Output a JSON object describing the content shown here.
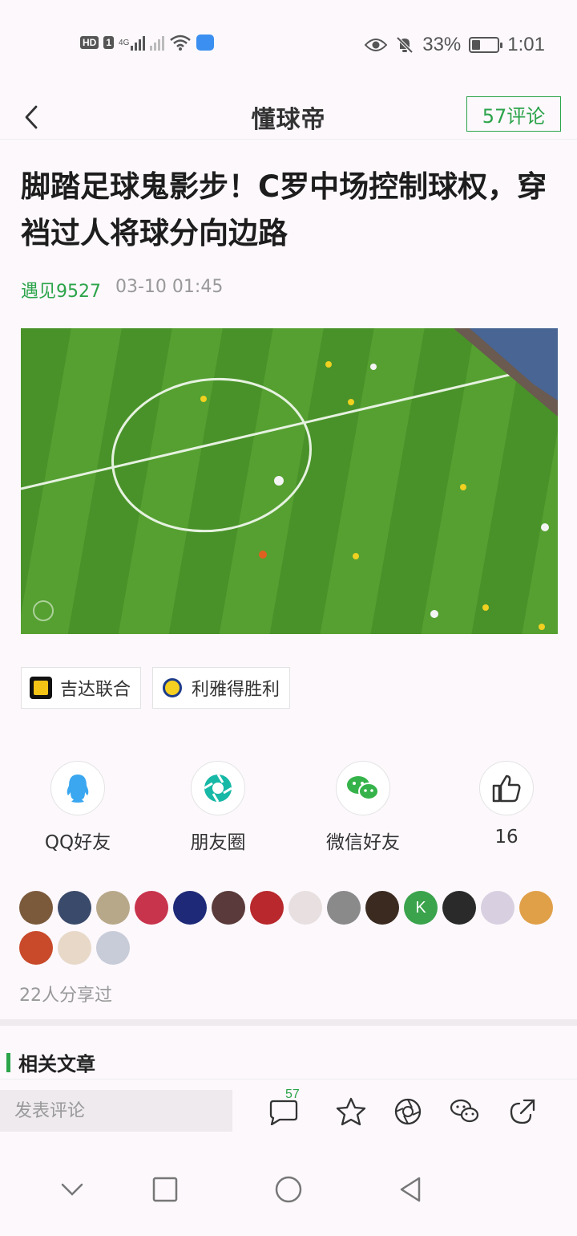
{
  "status_bar": {
    "left_hd": "HD",
    "left_sim": "1",
    "left_net": "4G",
    "battery_pct": "33%",
    "battery_level": 0.33,
    "time": "1:01"
  },
  "header": {
    "brand": "懂球帝",
    "comment_button": "57评论"
  },
  "article": {
    "title": "脚踏足球鬼影步！C罗中场控制球权，穿裆过人将球分向边路",
    "author": "遇见9527",
    "timestamp": "03-10 01:45"
  },
  "tags": [
    {
      "label": "吉达联合",
      "logo": "ittihad-logo",
      "color": "#f3c316"
    },
    {
      "label": "利雅得胜利",
      "logo": "al-nassr-logo",
      "color": "#f5d020"
    }
  ],
  "share": {
    "items": [
      {
        "label": "QQ好友",
        "icon": "qq-icon"
      },
      {
        "label": "朋友圈",
        "icon": "moments-icon"
      },
      {
        "label": "微信好友",
        "icon": "wechat-icon"
      },
      {
        "label": "16",
        "icon": "thumbs-up-icon"
      }
    ],
    "avatars": [
      {
        "color": "#7b5a3c",
        "text": ""
      },
      {
        "color": "#3a4a6a",
        "text": ""
      },
      {
        "color": "#b8a88a",
        "text": ""
      },
      {
        "color": "#c8344c",
        "text": ""
      },
      {
        "color": "#1e2a78",
        "text": ""
      },
      {
        "color": "#5a3a3a",
        "text": ""
      },
      {
        "color": "#b8282c",
        "text": ""
      },
      {
        "color": "#e8e0e0",
        "text": ""
      },
      {
        "color": "#8a8a8a",
        "text": ""
      },
      {
        "color": "#3a2a20",
        "text": ""
      },
      {
        "color": "#3aa34c",
        "text": "K"
      },
      {
        "color": "#2a2a2a",
        "text": ""
      },
      {
        "color": "#d8d0e0",
        "text": ""
      },
      {
        "color": "#e0a048",
        "text": ""
      },
      {
        "color": "#c84a2a",
        "text": ""
      },
      {
        "color": "#e8d8c8",
        "text": ""
      },
      {
        "color": "#c8ccd8",
        "text": ""
      }
    ],
    "shared_count": "22人分享过"
  },
  "related": {
    "heading": "相关文章"
  },
  "bottom_bar": {
    "comment_placeholder": "发表评论",
    "comment_badge": "57",
    "accent": "#2ca44a"
  }
}
